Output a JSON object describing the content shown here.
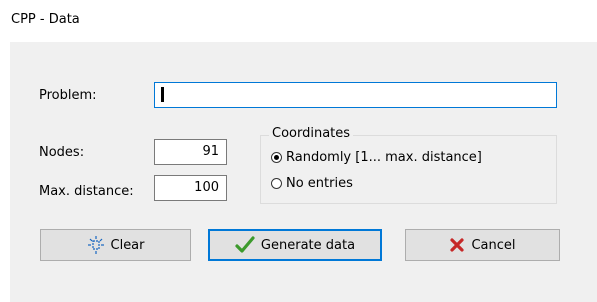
{
  "window": {
    "title": "CPP - Data"
  },
  "form": {
    "problem_label": "Problem:",
    "problem_value": "",
    "nodes_label": "Nodes:",
    "nodes_value": "91",
    "maxdist_label": "Max. distance:",
    "maxdist_value": "100"
  },
  "coordinates": {
    "title": "Coordinates",
    "options": [
      {
        "label": "Randomly  [1... max. distance]",
        "selected": true
      },
      {
        "label": "No entries",
        "selected": false
      }
    ]
  },
  "buttons": {
    "clear": "Clear",
    "generate": "Generate data",
    "cancel": "Cancel"
  },
  "colors": {
    "accent": "#0078d7",
    "check_green": "#3c9a2c",
    "cancel_red": "#c62828"
  },
  "icons": {
    "clear": "clear-icon",
    "generate": "checkmark-icon",
    "cancel": "cross-icon"
  }
}
